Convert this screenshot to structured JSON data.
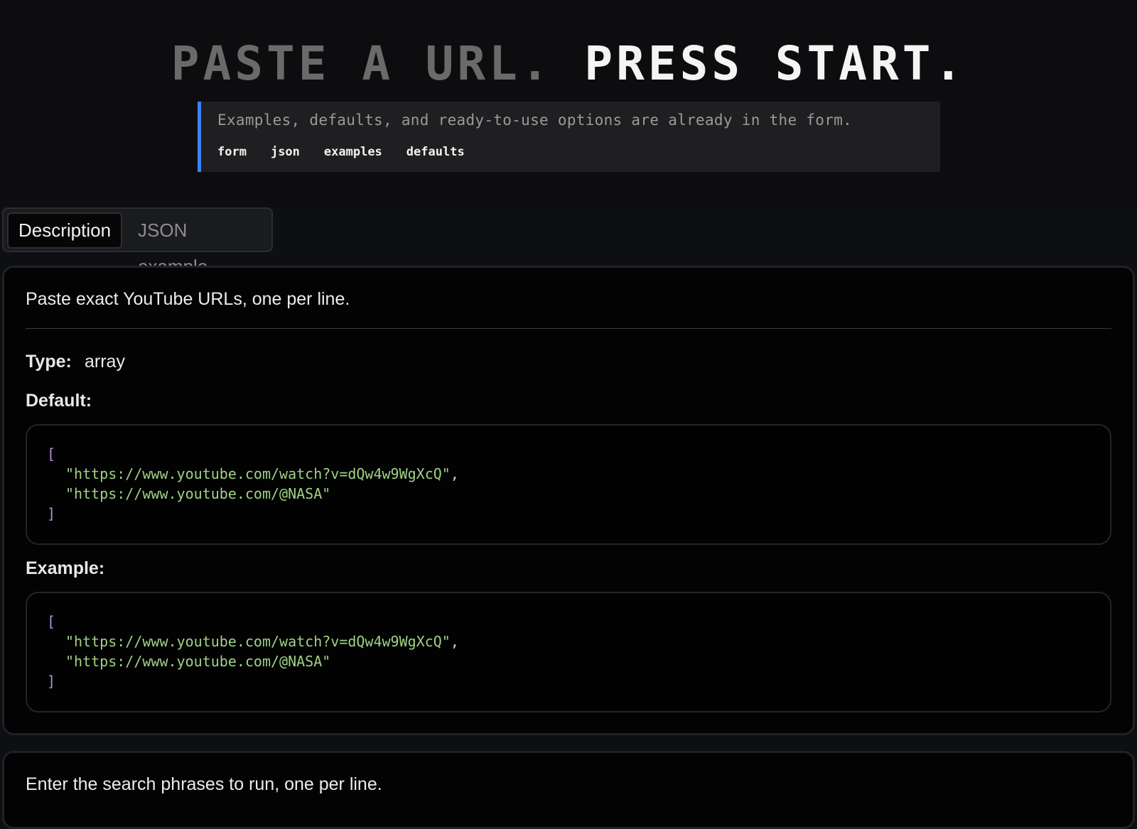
{
  "hero": {
    "title_dim": "PASTE A URL.",
    "title_bright": "PRESS START.",
    "callout_text": "Examples, defaults, and ready-to-use options are already in the form.",
    "tags": [
      "form",
      "json",
      "examples",
      "defaults"
    ],
    "accent_color": "#3b82f6"
  },
  "tabs": {
    "active_label": "Description",
    "inactive_label": "JSON example"
  },
  "field1": {
    "description": "Paste exact YouTube URLs, one per line.",
    "type_label": "Type:",
    "type_value": "array",
    "default_label": "Default:",
    "example_label": "Example:",
    "default_code": {
      "open": "[",
      "lines": [
        "\"https://www.youtube.com/watch?v=dQw4w9WgXcQ\"",
        "\"https://www.youtube.com/@NASA\""
      ],
      "comma": ",",
      "close": "]"
    },
    "example_code": {
      "open": "[",
      "lines": [
        "\"https://www.youtube.com/watch?v=dQw4w9WgXcQ\"",
        "\"https://www.youtube.com/@NASA\""
      ],
      "comma": ",",
      "close": "]"
    }
  },
  "field2": {
    "description": "Enter the search phrases to run, one per line."
  }
}
